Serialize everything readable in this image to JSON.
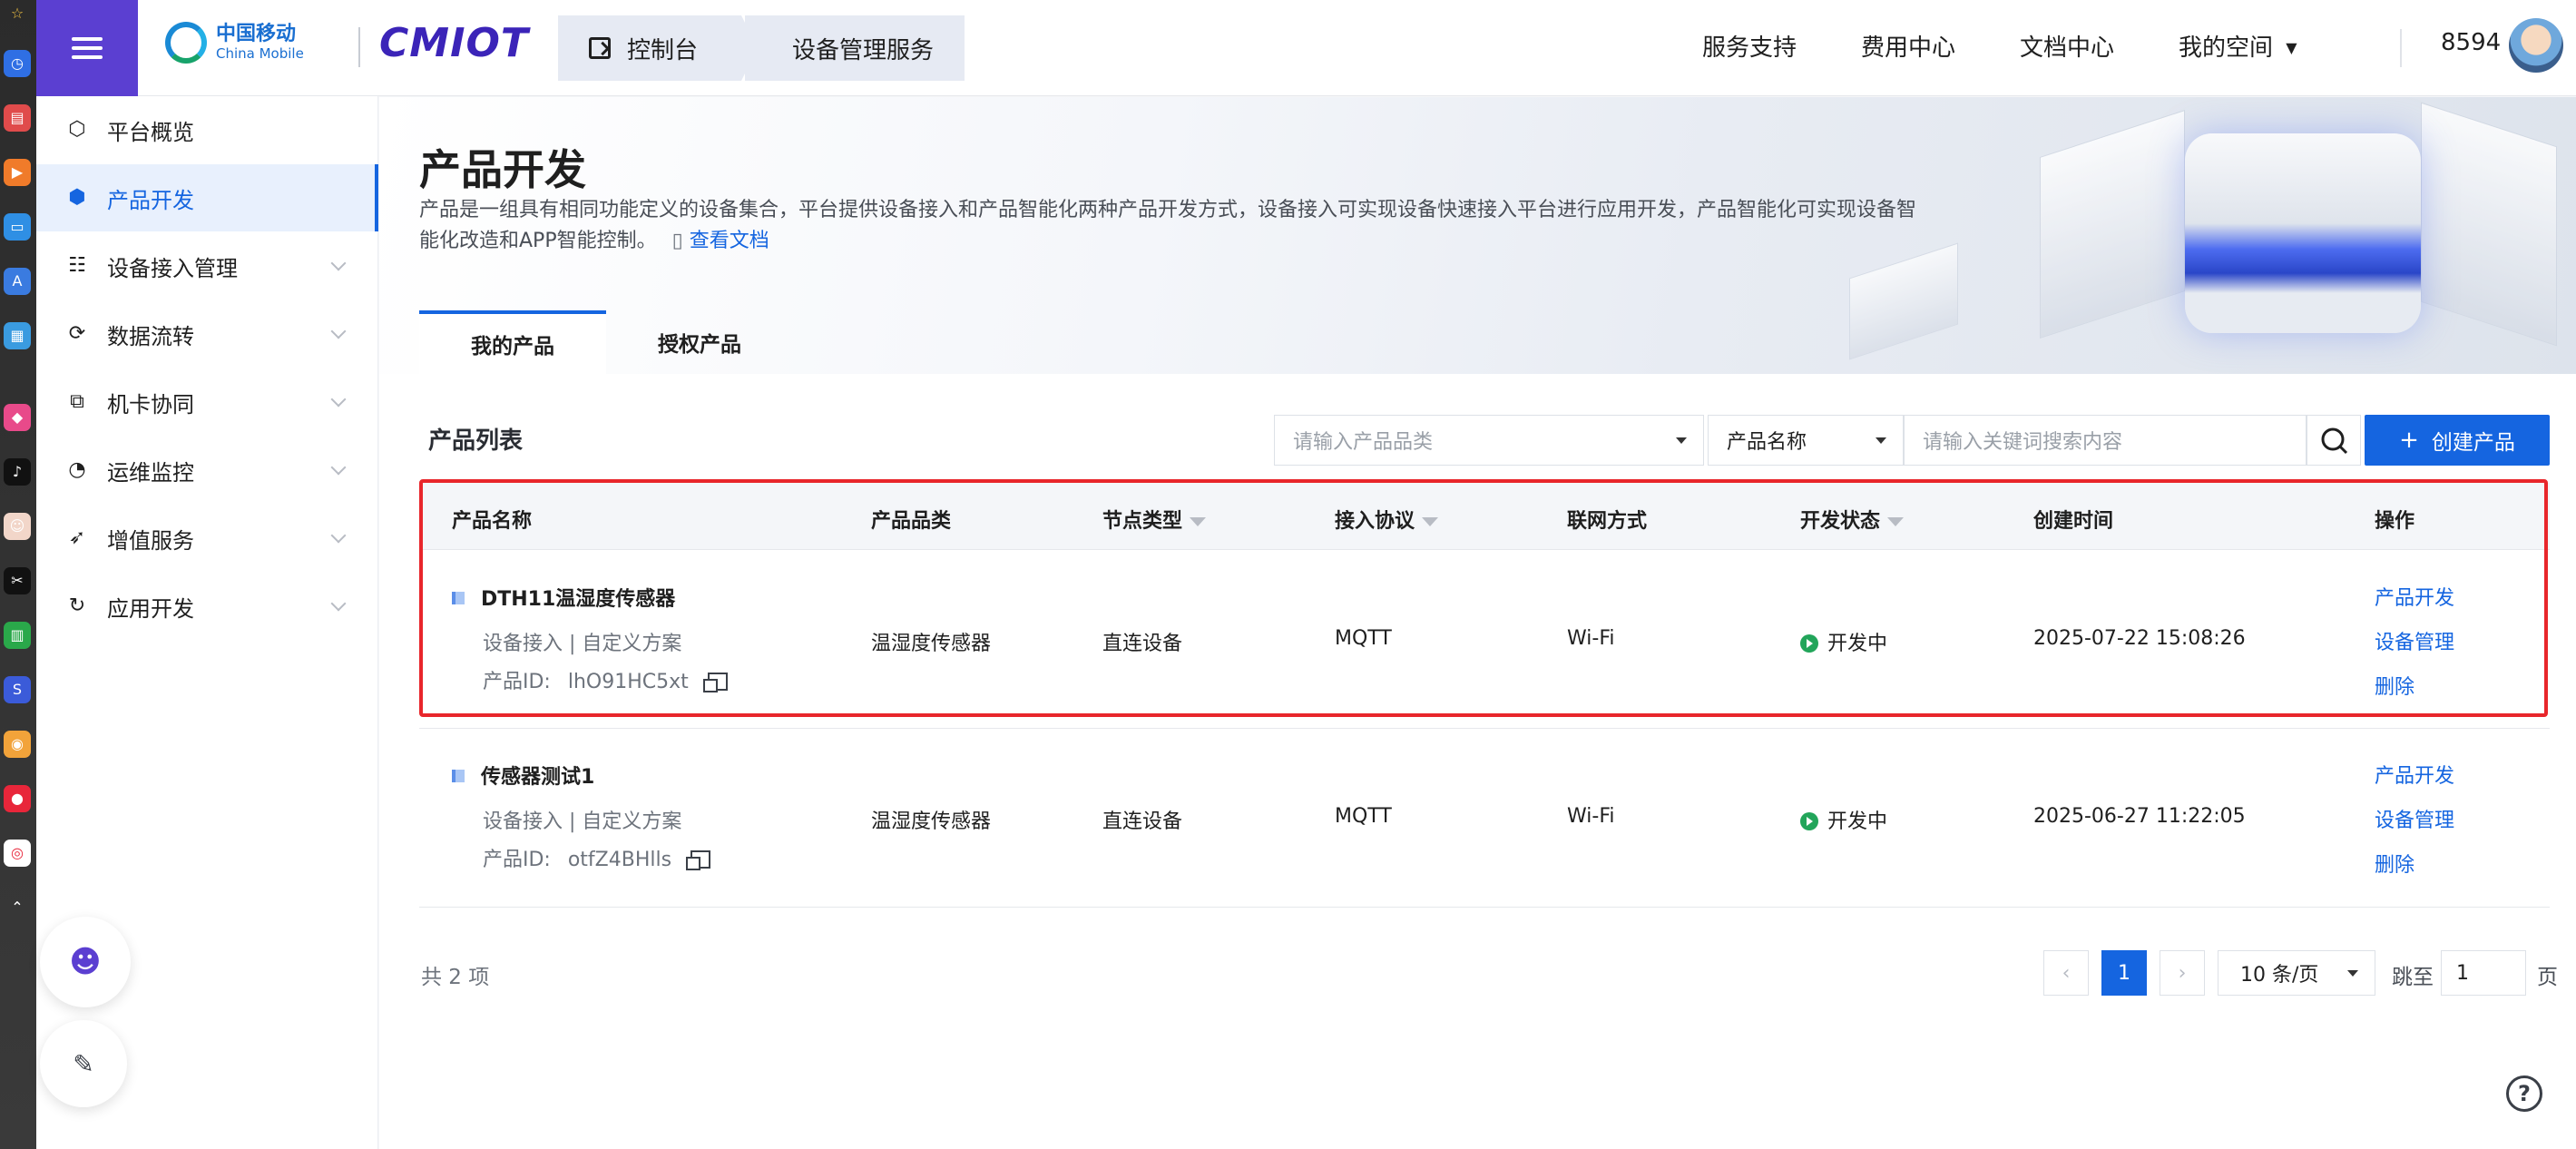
{
  "header": {
    "brand_cn": "中国移动",
    "brand_en": "China Mobile",
    "brand_product": "CMIOT",
    "breadcrumb": [
      "控制台",
      "设备管理服务"
    ],
    "nav": [
      "服务支持",
      "费用中心",
      "文档中心",
      "我的空间"
    ],
    "user_id": "8594"
  },
  "sidebar": {
    "items": [
      {
        "label": "平台概览",
        "icon": "overview-icon",
        "glyph": "⬡"
      },
      {
        "label": "产品开发",
        "icon": "product-cube-icon",
        "glyph": "⬢"
      },
      {
        "label": "设备接入管理",
        "icon": "device-access-icon",
        "glyph": "☷"
      },
      {
        "label": "数据流转",
        "icon": "data-flow-icon",
        "glyph": "⟳"
      },
      {
        "label": "机卡协同",
        "icon": "sim-card-icon",
        "glyph": "⧉"
      },
      {
        "label": "运维监控",
        "icon": "monitor-icon",
        "glyph": "◔"
      },
      {
        "label": "增值服务",
        "icon": "value-added-icon",
        "glyph": "➶"
      },
      {
        "label": "应用开发",
        "icon": "app-dev-icon",
        "glyph": "↻"
      }
    ]
  },
  "page": {
    "title": "产品开发",
    "description": "产品是一组具有相同功能定义的设备集合，平台提供设备接入和产品智能化两种产品开发方式，设备接入可实现设备快速接入平台进行应用开发，产品智能化可实现设备智能化改造和APP智能控制。",
    "doc_link": "查看文档",
    "tabs": [
      "我的产品",
      "授权产品"
    ]
  },
  "toolbar": {
    "list_title": "产品列表",
    "category_placeholder": "请输入产品品类",
    "search_field": "产品名称",
    "keyword_placeholder": "请输入关键词搜索内容",
    "create_label": "创建产品"
  },
  "table": {
    "columns": [
      "产品名称",
      "产品品类",
      "节点类型",
      "接入协议",
      "联网方式",
      "开发状态",
      "创建时间",
      "操作"
    ],
    "rows": [
      {
        "name": "DTH11温湿度传感器",
        "tags": "设备接入  |  自定义方案",
        "id_label": "产品ID:",
        "id": "lhO91HC5xt",
        "category": "温湿度传感器",
        "node": "直连设备",
        "protocol": "MQTT",
        "network": "Wi-Fi",
        "status": "开发中",
        "created": "2025-07-22 15:08:26",
        "actions": [
          "产品开发",
          "设备管理",
          "删除"
        ]
      },
      {
        "name": "传感器测试1",
        "tags": "设备接入  |  自定义方案",
        "id_label": "产品ID:",
        "id": "otfZ4BHlls",
        "category": "温湿度传感器",
        "node": "直连设备",
        "protocol": "MQTT",
        "network": "Wi-Fi",
        "status": "开发中",
        "created": "2025-06-27 11:22:05",
        "actions": [
          "产品开发",
          "设备管理",
          "删除"
        ]
      }
    ]
  },
  "pagination": {
    "total": "共 2 项",
    "current_page": "1",
    "page_size": "10 条/页",
    "jump_label": "跳至",
    "jump_value": "1",
    "page_suffix": "页"
  },
  "colors": {
    "brand_purple": "#5b3fd1",
    "primary": "#1565e0",
    "status_green": "#22a55a",
    "highlight_red": "#e8262b"
  }
}
